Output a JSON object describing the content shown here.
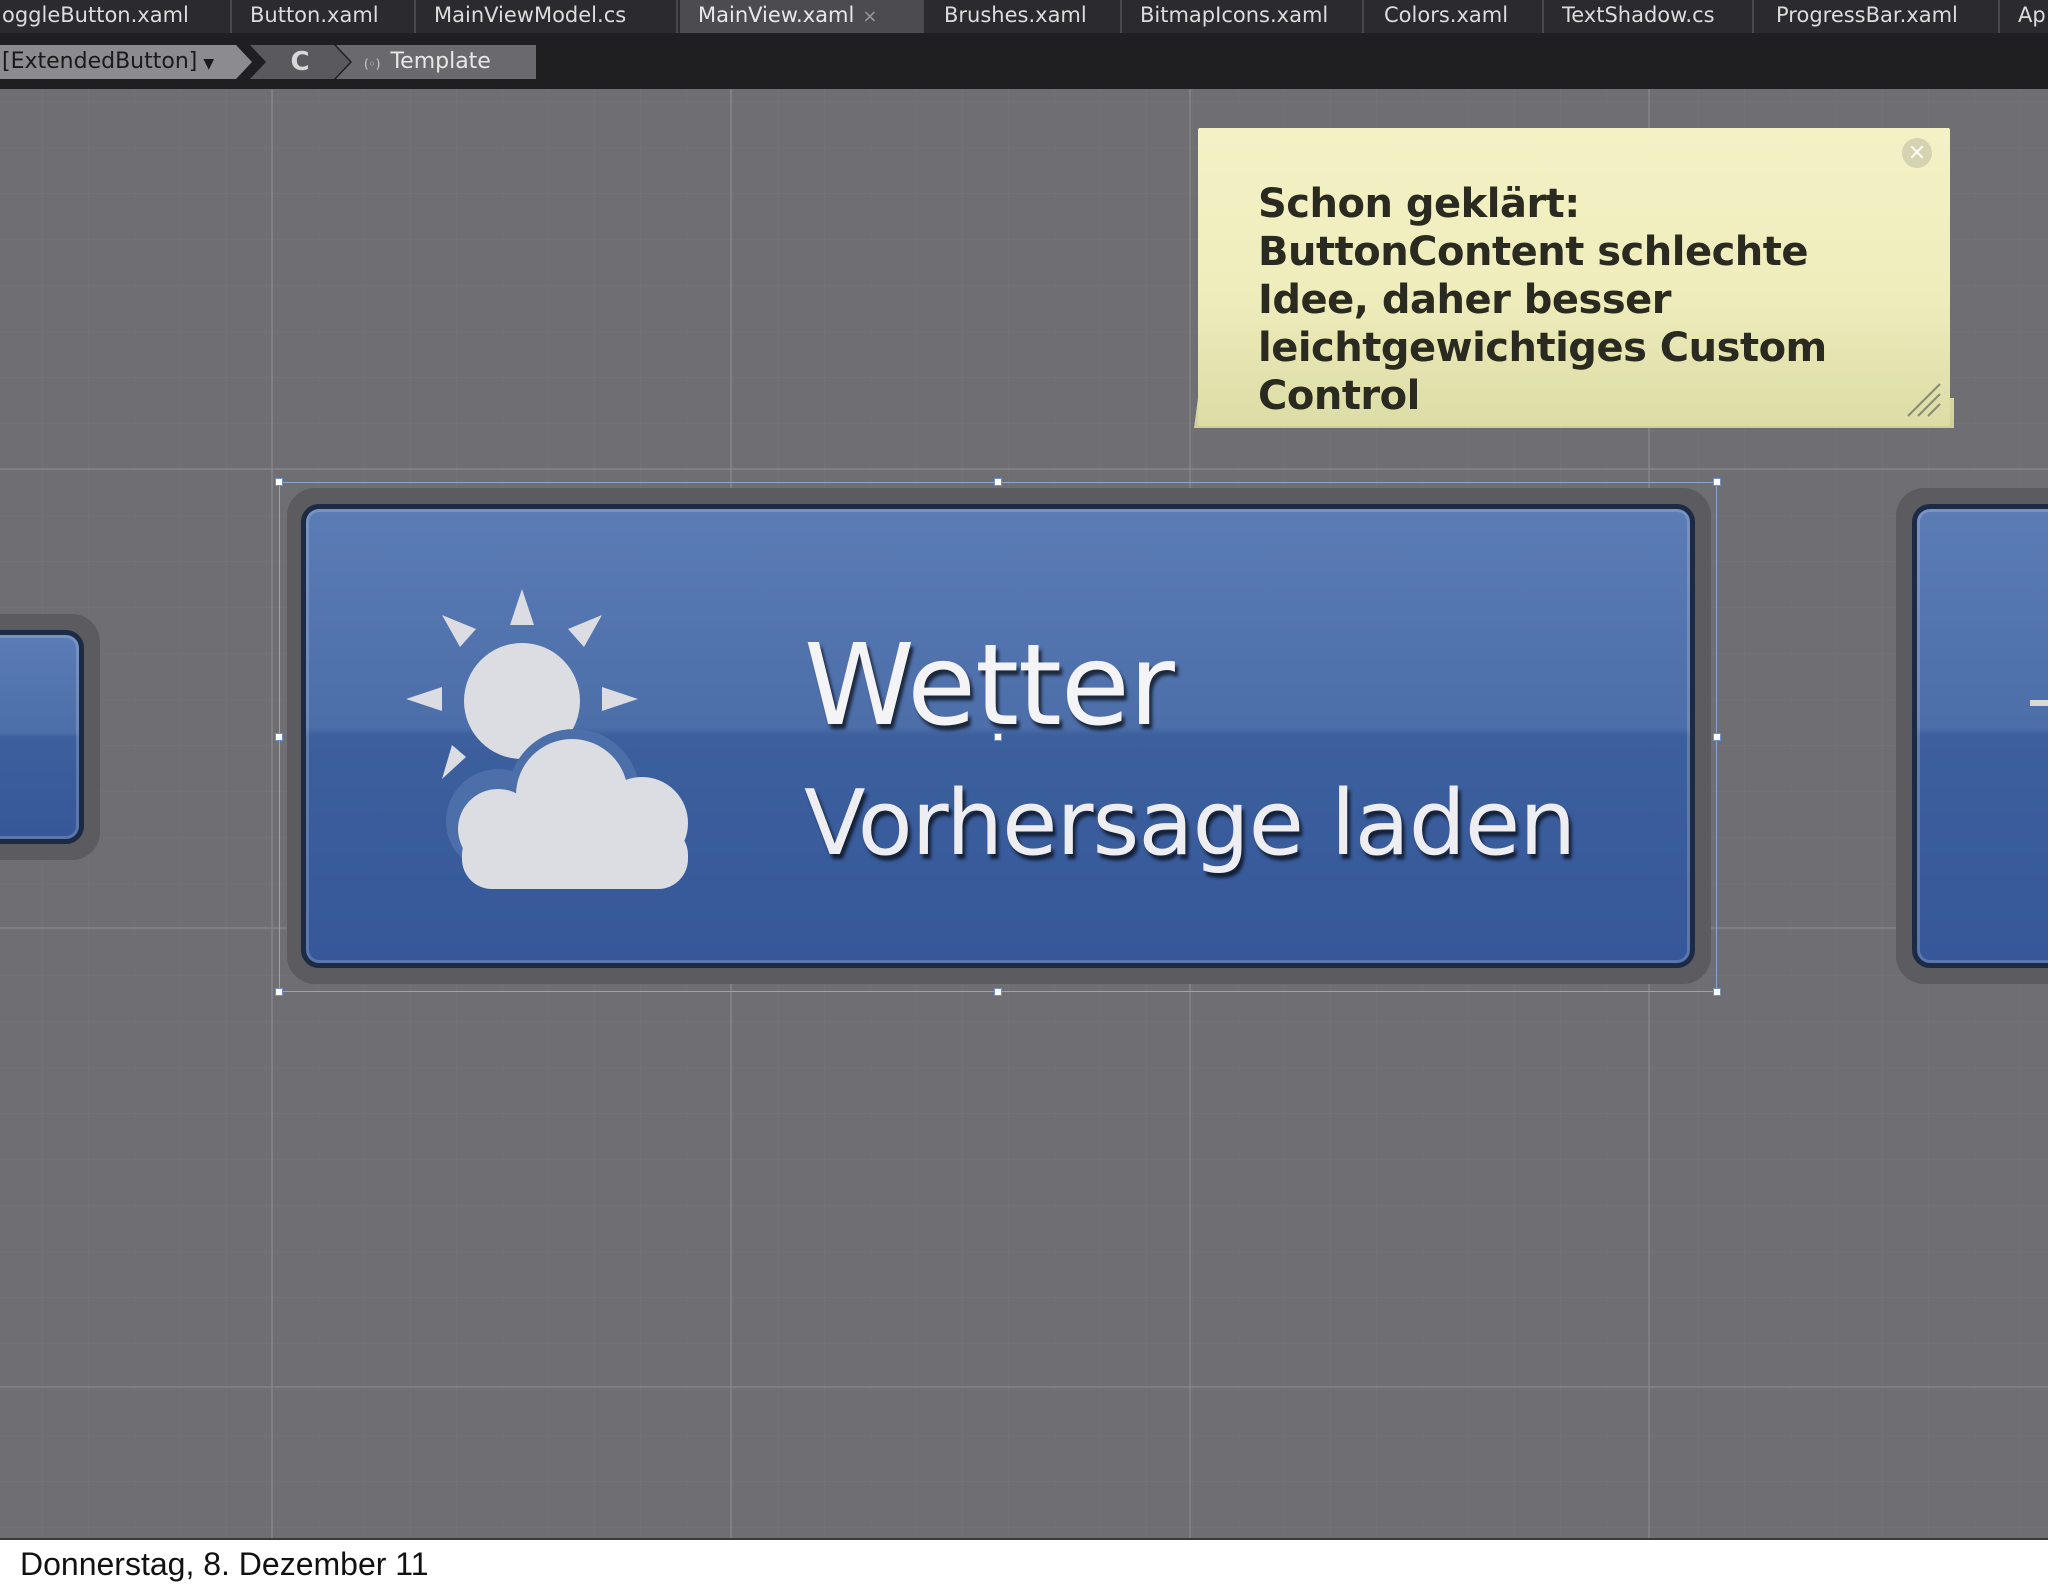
{
  "tabs": [
    {
      "label": "oggleButton.xaml",
      "active": false
    },
    {
      "label": "Button.xaml",
      "active": false
    },
    {
      "label": "MainViewModel.cs",
      "active": false
    },
    {
      "label": "MainView.xaml",
      "active": true,
      "close": "×"
    },
    {
      "label": "Brushes.xaml",
      "active": false
    },
    {
      "label": "BitmapIcons.xaml",
      "active": false
    },
    {
      "label": "Colors.xaml",
      "active": false
    },
    {
      "label": "TextShadow.cs",
      "active": false
    },
    {
      "label": "ProgressBar.xaml",
      "active": false
    },
    {
      "label": "Ap",
      "active": false
    }
  ],
  "breadcrumb": {
    "element": "[ExtendedButton]",
    "element_icon": "dropdown-arrow-icon",
    "style_glyph": "C",
    "template_icon": "template-icon",
    "template": "Template"
  },
  "note": {
    "text": "Schon geklärt: ButtonContent schlechte Idee, daher besser leichtgewichtiges Custom Control",
    "close_glyph": "×",
    "background": "#f1efc2"
  },
  "button": {
    "title": "Wetter",
    "subtitle": "Vorhersage laden",
    "icon": "weather-sun-cloud-icon",
    "fill": "#4b6ba8",
    "border": "#1c2a44"
  },
  "footer": {
    "date": "Donnerstag, 8. Dezember 11"
  }
}
